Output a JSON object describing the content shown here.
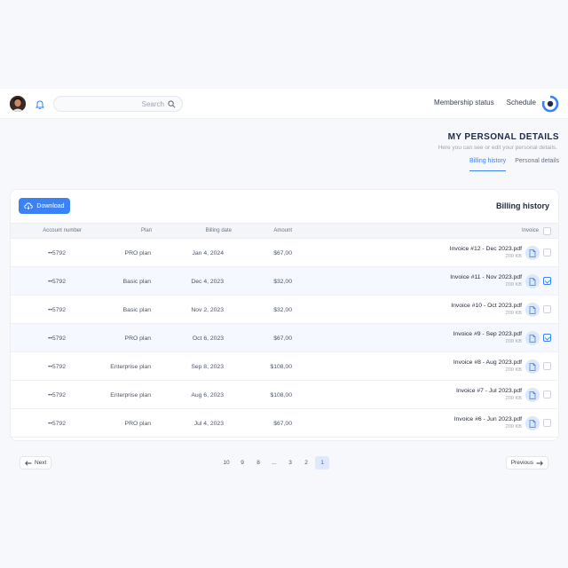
{
  "topbar": {
    "nav": [
      "Schedule",
      "Membership status"
    ],
    "search_placeholder": "Search"
  },
  "header": {
    "title": "MY PERSONAL DETAILS",
    "subtitle": "Here you can see or edit your personal details.",
    "tabs": [
      {
        "label": "Personal details",
        "active": false
      },
      {
        "label": "Billing history",
        "active": true
      }
    ]
  },
  "billing": {
    "title": "Billing history",
    "download_label": "Download",
    "columns": {
      "invoice": "Invoice",
      "amount": "Amount",
      "date": "Billing date",
      "plan": "Plan",
      "account": "Account number"
    },
    "rows": [
      {
        "name": "Invoice #12 - Dec 2023.pdf",
        "size": "200 KB",
        "amount": "$67,00",
        "date": "Jan 4, 2024",
        "plan": "PRO plan",
        "account": "••5792",
        "checked": false
      },
      {
        "name": "Invoice #11 - Nov 2023.pdf",
        "size": "200 KB",
        "amount": "$32,00",
        "date": "Dec 4, 2023",
        "plan": "Basic plan",
        "account": "••5792",
        "checked": true
      },
      {
        "name": "Invoice #10 - Oct 2023.pdf",
        "size": "200 KB",
        "amount": "$32,00",
        "date": "Nov 2, 2023",
        "plan": "Basic plan",
        "account": "••5792",
        "checked": false
      },
      {
        "name": "Invoice #9 - Sep 2023.pdf",
        "size": "200 KB",
        "amount": "$67,00",
        "date": "Oct 6, 2023",
        "plan": "PRO plan",
        "account": "••5792",
        "checked": true
      },
      {
        "name": "Invoice #8 - Aug 2023.pdf",
        "size": "200 KB",
        "amount": "$108,00",
        "date": "Sep 8, 2023",
        "plan": "Enterprise plan",
        "account": "••5792",
        "checked": false
      },
      {
        "name": "Invoice #7 - Jul 2023.pdf",
        "size": "200 KB",
        "amount": "$108,00",
        "date": "Aug 6, 2023",
        "plan": "Enterprise plan",
        "account": "••5792",
        "checked": false
      },
      {
        "name": "Invoice #6 - Jun 2023.pdf",
        "size": "200 KB",
        "amount": "$67,00",
        "date": "Jul 4, 2023",
        "plan": "PRO plan",
        "account": "••5792",
        "checked": false
      }
    ]
  },
  "pagination": {
    "previous_label": "Previous",
    "next_label": "Next",
    "pages": [
      "1",
      "2",
      "3",
      "...",
      "8",
      "9",
      "10"
    ],
    "active_page": "1"
  },
  "colors": {
    "accent": "#3b82f6",
    "title": "#1f2a44"
  }
}
